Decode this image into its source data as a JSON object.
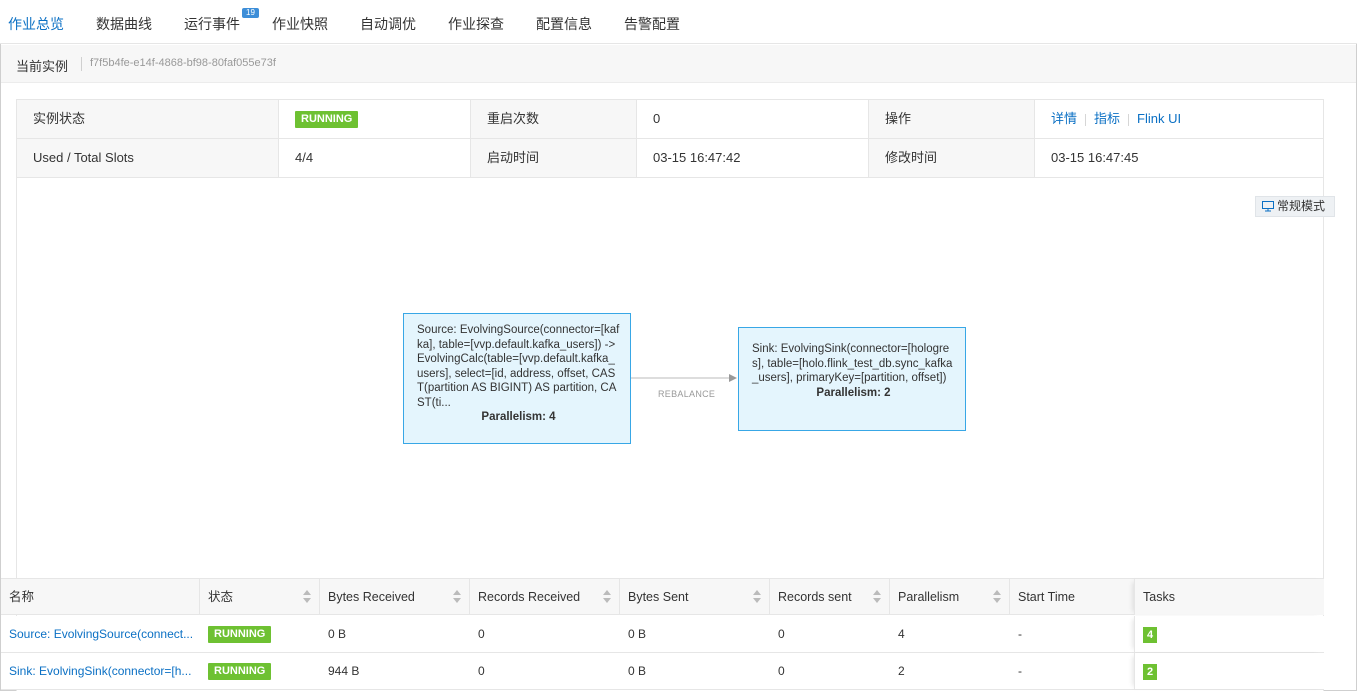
{
  "tabs": [
    {
      "label": "作业总览",
      "active": true
    },
    {
      "label": "数据曲线",
      "active": false
    },
    {
      "label": "运行事件",
      "active": false,
      "badge": "19"
    },
    {
      "label": "作业快照",
      "active": false
    },
    {
      "label": "自动调优",
      "active": false
    },
    {
      "label": "作业探查",
      "active": false
    },
    {
      "label": "配置信息",
      "active": false
    },
    {
      "label": "告警配置",
      "active": false
    }
  ],
  "instance": {
    "label": "当前实例",
    "id": "f7f5b4fe-e14f-4868-bf98-80faf055e73f"
  },
  "info": {
    "status_label": "实例状态",
    "status_value": "RUNNING",
    "restart_label": "重启次数",
    "restart_value": "0",
    "ops_label": "操作",
    "ops": [
      "详情",
      "指标",
      "Flink UI"
    ],
    "slots_label": "Used / Total Slots",
    "slots_value": "4/4",
    "start_label": "启动时间",
    "start_value": "03-15 16:47:42",
    "modify_label": "修改时间",
    "modify_value": "03-15 16:47:45"
  },
  "graph": {
    "mode_button": "常规模式",
    "nodes": [
      {
        "text": "Source: EvolvingSource(connector=[kafka], table=[vvp.default.kafka_users]) -> EvolvingCalc(table=[vvp.default.kafka_users], select=[id, address, offset, CAST(partition AS BIGINT) AS partition, CAST(ti...",
        "parallelism": "Parallelism: 4"
      },
      {
        "text": "Sink: EvolvingSink(connector=[hologres], table=[holo.flink_test_db.sync_kafka_users], primaryKey=[partition, offset])",
        "parallelism": "Parallelism: 2"
      }
    ],
    "edge_label": "REBALANCE"
  },
  "table": {
    "headers": [
      "名称",
      "状态",
      "Bytes Received",
      "Records Received",
      "Bytes Sent",
      "Records sent",
      "Parallelism",
      "Start Time",
      "Tasks"
    ],
    "rows": [
      {
        "name": "Source: EvolvingSource(connect...",
        "state": "RUNNING",
        "bytes_received": "0 B",
        "records_received": "0",
        "bytes_sent": "0 B",
        "records_sent": "0",
        "parallelism": "4",
        "start_time": "-",
        "tasks": "4"
      },
      {
        "name": "Sink: EvolvingSink(connector=[h...",
        "state": "RUNNING",
        "bytes_received": "944 B",
        "records_received": "0",
        "bytes_sent": "0 B",
        "records_sent": "0",
        "parallelism": "2",
        "start_time": "-",
        "tasks": "2"
      }
    ]
  },
  "colors": {
    "accent": "#0b70c4",
    "running": "#6ec132",
    "node_fill": "#e4f5fd",
    "node_border": "#38a7e6"
  }
}
